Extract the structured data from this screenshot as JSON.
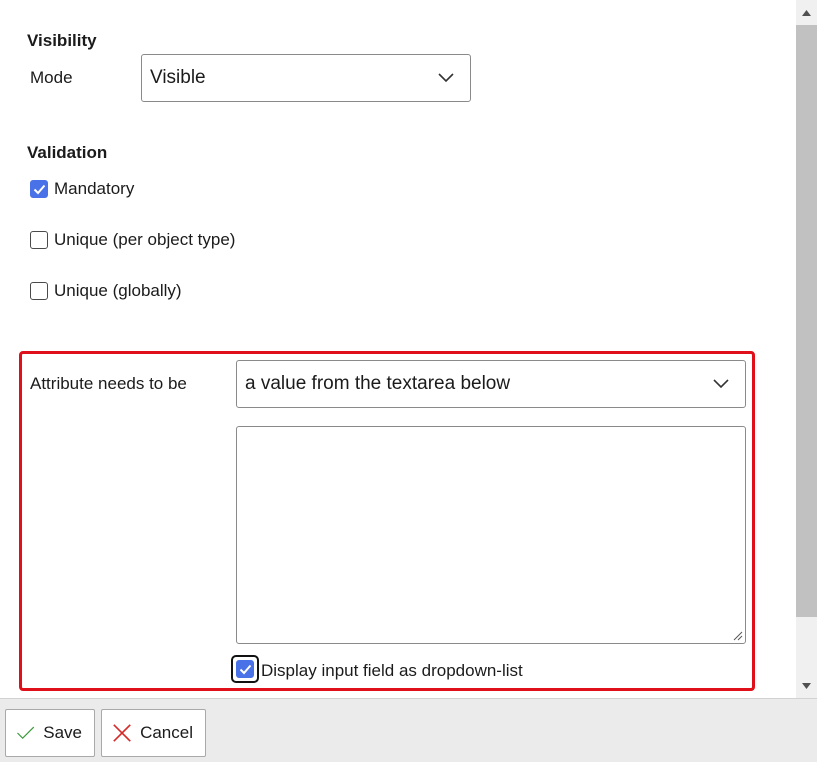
{
  "visibility": {
    "title": "Visibility",
    "mode_label": "Mode",
    "mode_value": "Visible"
  },
  "validation": {
    "title": "Validation",
    "options": [
      {
        "label": "Mandatory",
        "checked": true
      },
      {
        "label": "Unique (per object type)",
        "checked": false
      },
      {
        "label": "Unique (globally)",
        "checked": false
      }
    ]
  },
  "attribute": {
    "label": "Attribute needs to be",
    "select_value": "a value from the textarea below",
    "textarea_value": "",
    "dropdown_option_label": "Display input field as dropdown-list",
    "dropdown_option_checked": true
  },
  "footer": {
    "save_label": "Save",
    "cancel_label": "Cancel"
  },
  "colors": {
    "checkbox_accent": "#4a72e8",
    "highlight_border": "#e0101a",
    "save_icon": "#3a9a3a",
    "cancel_icon": "#d42a2a"
  },
  "icons": {
    "select_chevron": "chevron-down-icon",
    "save": "checkmark-icon",
    "cancel": "close-icon"
  }
}
